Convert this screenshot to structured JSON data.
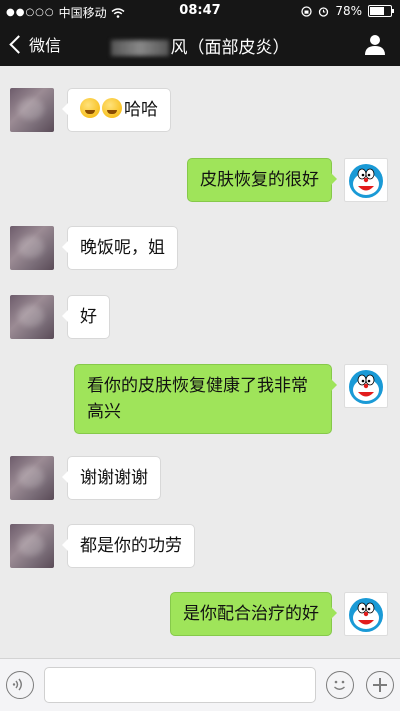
{
  "status_bar": {
    "carrier": "中国移动",
    "time": "08:47",
    "battery": "78%",
    "battery_level": 0.78
  },
  "nav": {
    "back_label": "微信",
    "title": "风（面部皮炎）"
  },
  "messages": [
    {
      "side": "in",
      "text": "哈哈",
      "emojis": 2
    },
    {
      "side": "out",
      "text": "皮肤恢复的很好"
    },
    {
      "side": "in",
      "text": "晚饭呢，姐"
    },
    {
      "side": "in",
      "text": "好"
    },
    {
      "side": "out",
      "text": "看你的皮肤恢复健康了我非常高兴"
    },
    {
      "side": "in",
      "text": "谢谢谢谢"
    },
    {
      "side": "in",
      "text": "都是你的功劳"
    },
    {
      "side": "out",
      "text": "是你配合治疗的好"
    }
  ],
  "input": {
    "value": ""
  },
  "icons": {
    "back": "chevron-left-icon",
    "contact": "person-icon",
    "voice": "voice-icon",
    "emoji": "emoji-icon",
    "more": "plus-icon"
  },
  "colors": {
    "out_bubble": "#9fe45a",
    "in_bubble": "#ffffff",
    "nav_bg": "#161616",
    "chat_bg": "#ebebeb"
  }
}
